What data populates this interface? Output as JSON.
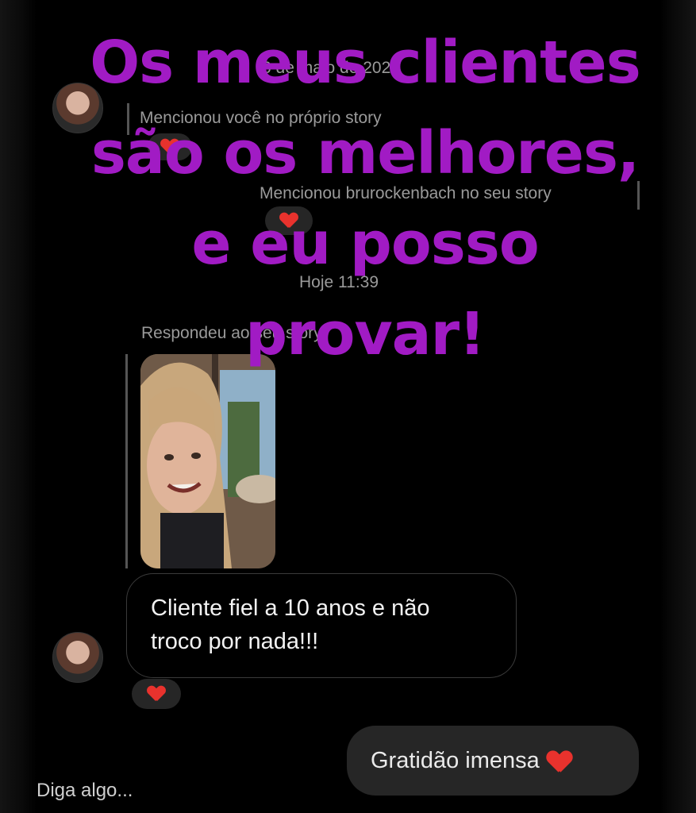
{
  "overlay": {
    "lines": [
      "Os meus clientes",
      "são os melhores,",
      "e eu posso",
      "provar!"
    ]
  },
  "thread": {
    "date_top": "6 de maio de 2020",
    "mention_received": "Mencionou você no próprio story",
    "mention_sent": "Mencionou brurockenbach no seu story",
    "date_today": "Hoje 11:39",
    "replied_label": "Respondeu ao seu story",
    "message_received": [
      "Cliente fiel a 10 anos e não",
      "troco por nada!!!"
    ],
    "message_sent": "Gratidão imensa"
  },
  "composer": {
    "placeholder": "Diga algo..."
  },
  "colors": {
    "overlay_text": "#a11bc4",
    "heart": "#e8322d",
    "bubble_sent": "#262626"
  },
  "icons": [
    "heart-icon",
    "avatar"
  ]
}
